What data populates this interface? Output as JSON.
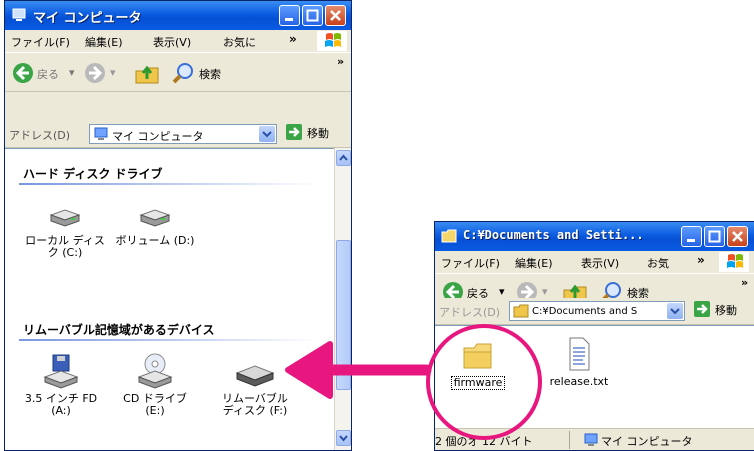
{
  "left_window": {
    "title": "マイ コンピュータ",
    "menu": [
      "ファイル(F)",
      "編集(E)",
      "表示(V)",
      "お気に"
    ],
    "menu_more": "»",
    "toolbar": {
      "back": "戻る",
      "search": "検索",
      "more": "»"
    },
    "address": {
      "label": "アドレス(D)",
      "value": "マイ コンピュータ",
      "go": "移動"
    },
    "groups": [
      {
        "title": "ハード ディスク ドライブ",
        "items": [
          {
            "label": "ローカル ディスク (C:)",
            "icon": "hard-disk-icon"
          },
          {
            "label": "ボリューム (D:)",
            "icon": "hard-disk-icon"
          }
        ]
      },
      {
        "title": "リムーバブル記憶域があるデバイス",
        "items": [
          {
            "label": "3.5 インチ FD (A:)",
            "icon": "floppy-drive-icon"
          },
          {
            "label": "CD ドライブ (E:)",
            "icon": "cd-drive-icon"
          },
          {
            "label": "リムーバブル ディスク (F:)",
            "icon": "removable-disk-icon"
          }
        ]
      }
    ]
  },
  "right_window": {
    "title": "C:¥Documents and Setti...",
    "menu": [
      "ファイル(F)",
      "編集(E)",
      "表示(V)",
      "お気"
    ],
    "menu_more": "»",
    "toolbar": {
      "back": "戻る",
      "search": "検索",
      "more": "»"
    },
    "address": {
      "label": "アドレス(D)",
      "value": "C:¥Documents and S",
      "go": "移動"
    },
    "files": [
      {
        "label": "firmware",
        "icon": "folder-icon"
      },
      {
        "label": "release.txt",
        "icon": "text-file-icon"
      }
    ],
    "status": {
      "left": "2 個のオ 12 バイト",
      "right": "マイ コンピュータ"
    }
  },
  "colors": {
    "xp_title": "#0b5ce0",
    "highlight": "#e8177f"
  }
}
